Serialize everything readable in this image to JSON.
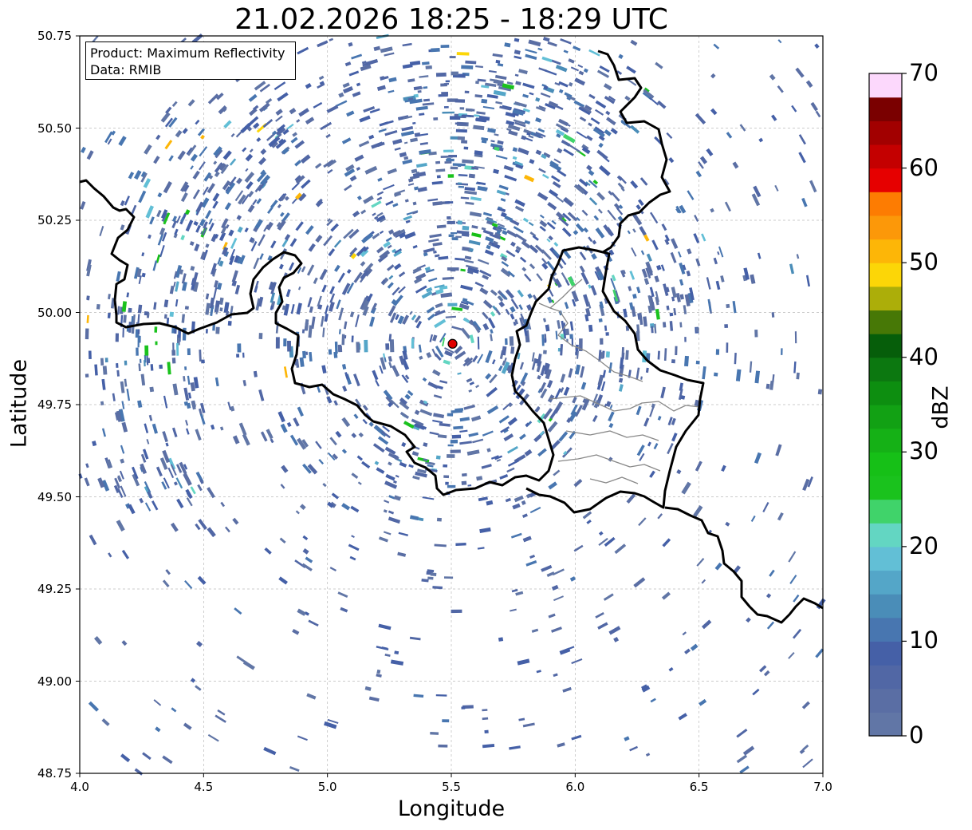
{
  "title": "21.02.2026 18:25 - 18:29 UTC",
  "info_box": {
    "product": "Product: Maximum Reflectivity",
    "data": "Data: RMIB"
  },
  "chart_data": {
    "type": "heatmap",
    "title": "21.02.2026 18:25 - 18:29 UTC",
    "xlabel": "Longitude",
    "ylabel": "Latitude",
    "xlim": [
      4.0,
      7.0
    ],
    "ylim": [
      48.75,
      50.75
    ],
    "x_ticks": [
      "4.0",
      "4.5",
      "5.0",
      "5.5",
      "6.0",
      "6.5",
      "7.0"
    ],
    "y_ticks": [
      "48.75",
      "49.00",
      "49.25",
      "49.50",
      "49.75",
      "50.00",
      "50.25",
      "50.50",
      "50.75"
    ],
    "grid": true,
    "radar_site": {
      "lon": 5.505,
      "lat": 49.915
    },
    "colorbar": {
      "label": "dBZ",
      "range": [
        0,
        70
      ],
      "ticks": [
        "0",
        "10",
        "20",
        "30",
        "40",
        "50",
        "60",
        "70"
      ],
      "step": 2.5,
      "colors": [
        "#6176a6",
        "#5a6ea4",
        "#5167a5",
        "#4560a7",
        "#4876b0",
        "#4a8db8",
        "#54a6c8",
        "#62bfd6",
        "#63d6c2",
        "#40d36a",
        "#1ac21d",
        "#16c017",
        "#15b116",
        "#12a114",
        "#0d8e10",
        "#0c7810",
        "#065e0a",
        "#477806",
        "#acae09",
        "#fcd607",
        "#fdb607",
        "#fc9809",
        "#fd7c02",
        "#e60000",
        "#c40000",
        "#a20000",
        "#7a0000",
        "#fcd8fc",
        "#fca8fc",
        "#f96ef9",
        "#f13bee"
      ]
    }
  }
}
